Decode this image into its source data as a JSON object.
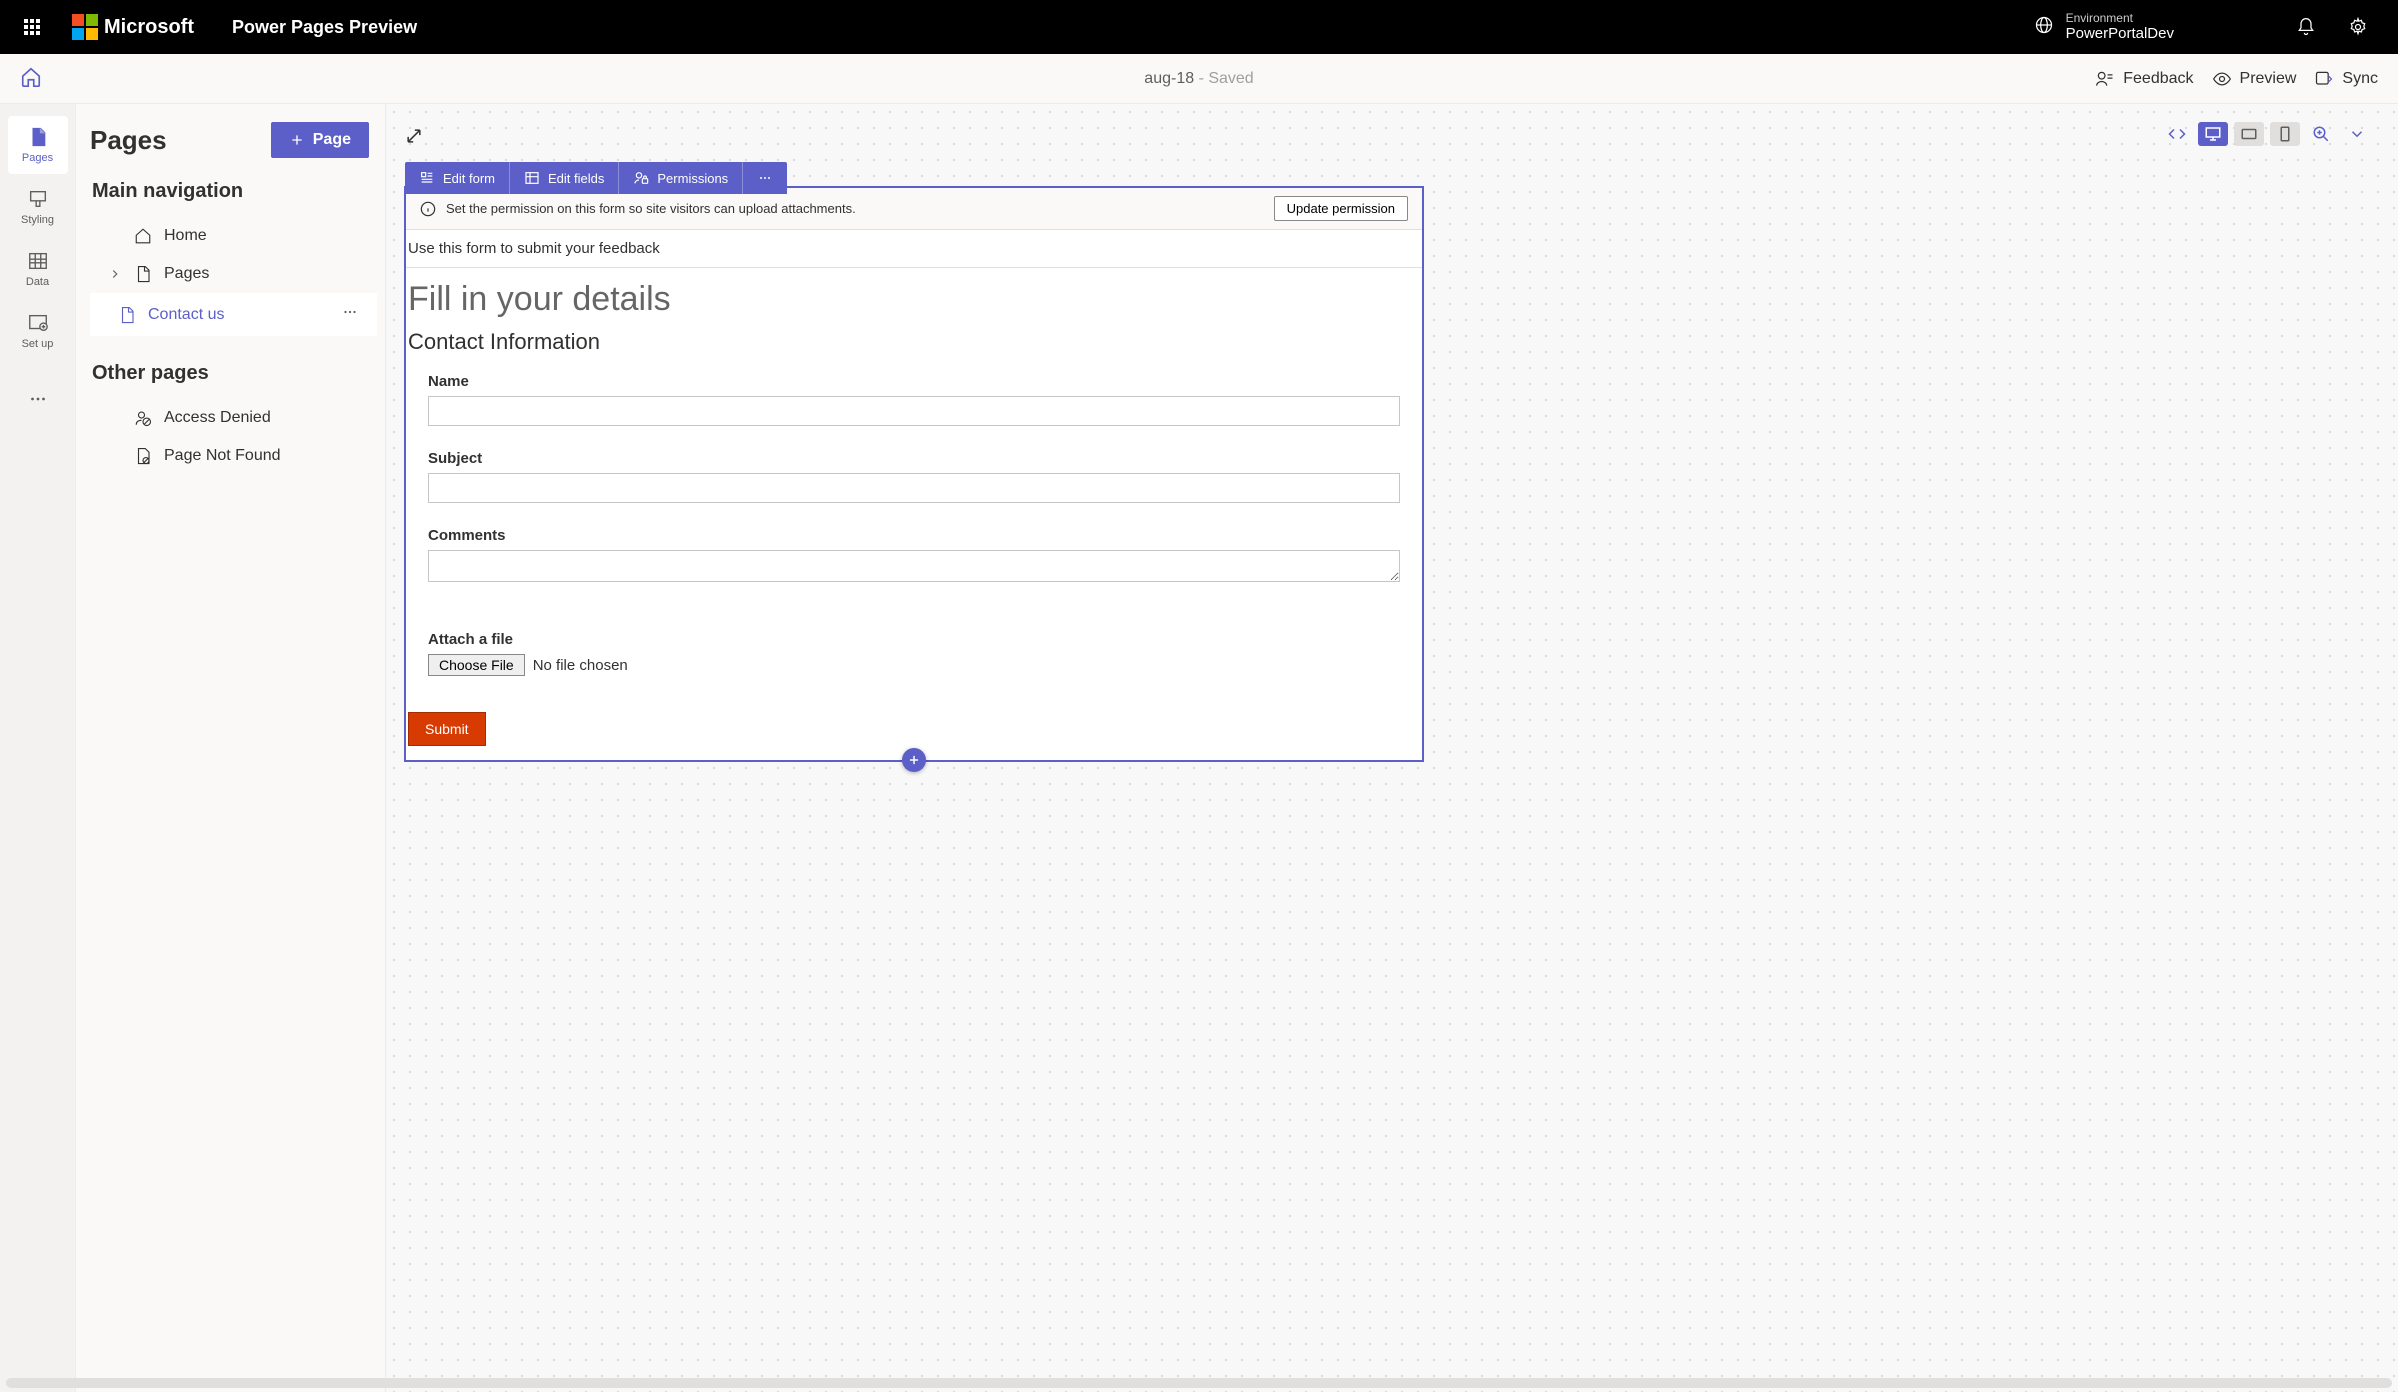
{
  "header": {
    "brand": "Microsoft",
    "app_title": "Power Pages Preview",
    "env_label": "Environment",
    "env_name": "PowerPortalDev"
  },
  "cmdbar": {
    "doc_name": "aug-18",
    "save_state": " - Saved",
    "feedback": "Feedback",
    "preview": "Preview",
    "sync": "Sync"
  },
  "rail": {
    "pages": "Pages",
    "styling": "Styling",
    "data": "Data",
    "setup": "Set up"
  },
  "side": {
    "title": "Pages",
    "new_page_btn": "Page",
    "section_main": "Main navigation",
    "item_home": "Home",
    "item_pages": "Pages",
    "item_contact": "Contact us",
    "section_other": "Other pages",
    "item_denied": "Access Denied",
    "item_notfound": "Page Not Found"
  },
  "formbar": {
    "edit_form": "Edit form",
    "edit_fields": "Edit fields",
    "permissions": "Permissions"
  },
  "banner": {
    "text": "Set the permission on this form so site visitors can upload attachments.",
    "button": "Update permission"
  },
  "form": {
    "intro": "Use this form to submit your feedback",
    "heading": "Fill in your details",
    "section": "Contact Information",
    "name_label": "Name",
    "subject_label": "Subject",
    "comments_label": "Comments",
    "attach_label": "Attach a file",
    "choose_file": "Choose File",
    "no_file": "No file chosen",
    "submit": "Submit"
  }
}
